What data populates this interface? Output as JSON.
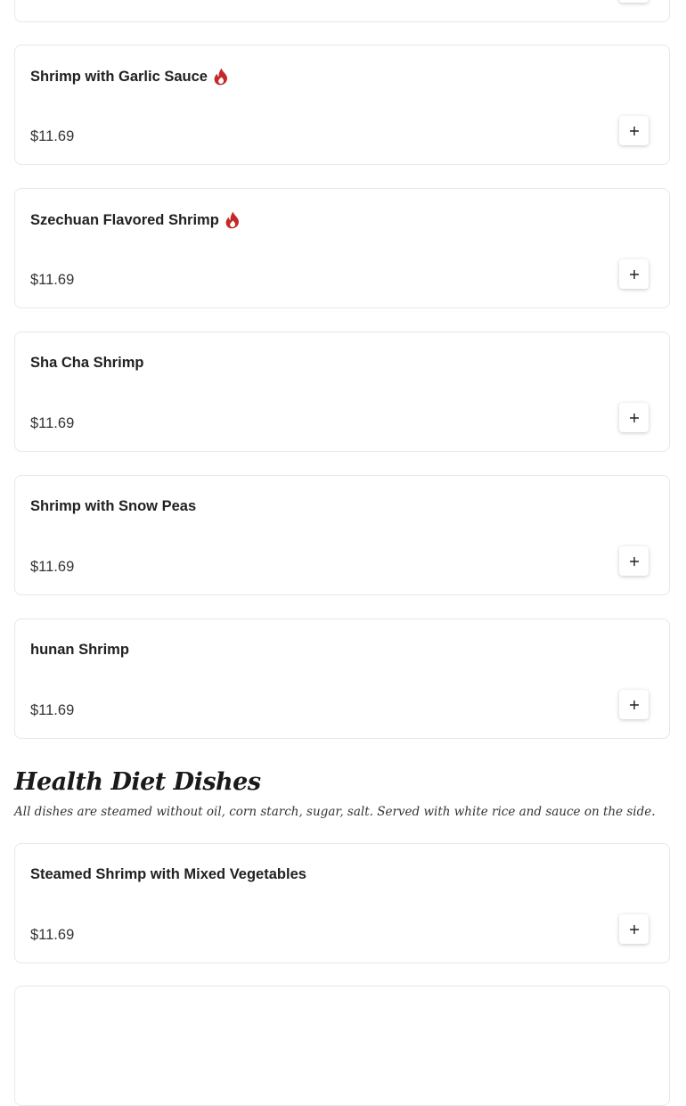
{
  "colors": {
    "spicy_icon": "#c62828",
    "border": "#e8e8e8"
  },
  "items": [
    {
      "name": "Shrimp with Garlic Sauce",
      "price": "$11.69",
      "spicy": true,
      "add_icon": "plus-icon"
    },
    {
      "name": "Szechuan Flavored Shrimp",
      "price": "$11.69",
      "spicy": true,
      "add_icon": "plus-icon"
    },
    {
      "name": "Sha Cha Shrimp",
      "price": "$11.69",
      "spicy": false,
      "add_icon": "plus-icon"
    },
    {
      "name": "Shrimp with Snow Peas",
      "price": "$11.69",
      "spicy": false,
      "add_icon": "plus-icon"
    },
    {
      "name": "hunan Shrimp",
      "price": "$11.69",
      "spicy": false,
      "add_icon": "plus-icon"
    }
  ],
  "section": {
    "title": "Health Diet Dishes",
    "description": "All dishes are steamed without oil, corn starch, sugar, salt. Served with white rice and sauce on the side."
  },
  "section_items": [
    {
      "name": "Steamed Shrimp with Mixed Vegetables",
      "price": "$11.69",
      "spicy": false,
      "add_icon": "plus-icon"
    }
  ]
}
